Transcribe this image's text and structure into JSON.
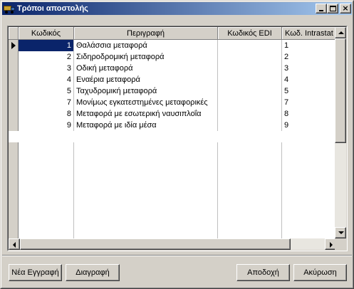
{
  "window": {
    "title": "Τρόποι αποστολής",
    "icon": "delivery-truck-icon"
  },
  "title_buttons": {
    "minimize": "0",
    "maximize": "1",
    "close": "×"
  },
  "grid": {
    "columns": [
      "Κωδικός",
      "Περιγραφή",
      "Κωδικός EDI",
      "Κωδ. Intrastat"
    ],
    "rows": [
      {
        "code": "1",
        "description": "Θαλάσσια μεταφορά",
        "edi": "",
        "intrastat": "1"
      },
      {
        "code": "2",
        "description": "Σιδηροδρομική μεταφορά",
        "edi": "",
        "intrastat": "2"
      },
      {
        "code": "3",
        "description": "Οδική μεταφορά",
        "edi": "",
        "intrastat": "3"
      },
      {
        "code": "4",
        "description": "Εναέρια μεταφορά",
        "edi": "",
        "intrastat": "4"
      },
      {
        "code": "5",
        "description": "Ταχυδρομική μεταφορά",
        "edi": "",
        "intrastat": "5"
      },
      {
        "code": "7",
        "description": "Μονίμως εγκατεστημένες μεταφορικές",
        "edi": "",
        "intrastat": "7"
      },
      {
        "code": "8",
        "description": "Μεταφορά με εσωτερική ναυσιπλοΐα",
        "edi": "",
        "intrastat": "8"
      },
      {
        "code": "9",
        "description": "Μεταφορά με ιδία μέσα",
        "edi": "",
        "intrastat": "9"
      }
    ],
    "selected_row": 0
  },
  "buttons": {
    "new_record": "Νέα Εγγραφή",
    "delete": "Διαγραφή",
    "accept": "Αποδοχή",
    "cancel": "Ακύρωση"
  }
}
